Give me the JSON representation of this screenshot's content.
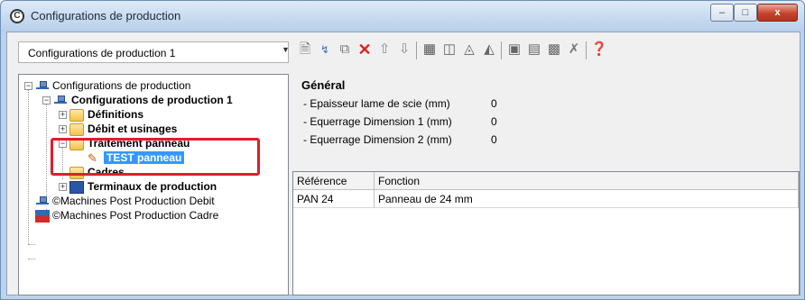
{
  "window": {
    "title": "Configurations de production",
    "minimize_glyph": "–",
    "maximize_glyph": "□",
    "close_glyph": "x"
  },
  "combo": {
    "selected": "Configurations de production 1"
  },
  "toolbar": {
    "icons": [
      "new-doc-icon",
      "copy-branch-icon",
      "duplicate-icon",
      "delete-icon",
      "move-up-icon",
      "move-down-icon",
      "properties-icon",
      "tool-1-icon",
      "tool-2-icon",
      "tool-3-icon",
      "tool-4-icon",
      "tool-5-icon",
      "tool-6-icon",
      "disable-icon",
      "help-icon"
    ]
  },
  "tree": {
    "root": "Configurations de production",
    "config": "Configurations de production 1",
    "definitions": "Définitions",
    "debit": "Débit et usinages",
    "traitement": "Traitement panneau",
    "test": "TEST panneau",
    "cadres": "Cadres",
    "terminaux": "Terminaux de production",
    "machines_debit": "©Machines Post Production Debit",
    "machines_cadre": "©Machines Post Production Cadre"
  },
  "general": {
    "title": "Général",
    "props": [
      {
        "label": "- Epaisseur lame de scie (mm)",
        "value": "0"
      },
      {
        "label": "- Equerrage Dimension 1 (mm)",
        "value": "0"
      },
      {
        "label": "- Equerrage Dimension 2 (mm)",
        "value": "0"
      }
    ]
  },
  "grid": {
    "columns": [
      "Référence",
      "Fonction"
    ],
    "rows": [
      [
        "PAN 24",
        "Panneau de 24 mm"
      ]
    ]
  },
  "colors": {
    "selection": "#3399ff",
    "highlight": "#e01e2a"
  }
}
